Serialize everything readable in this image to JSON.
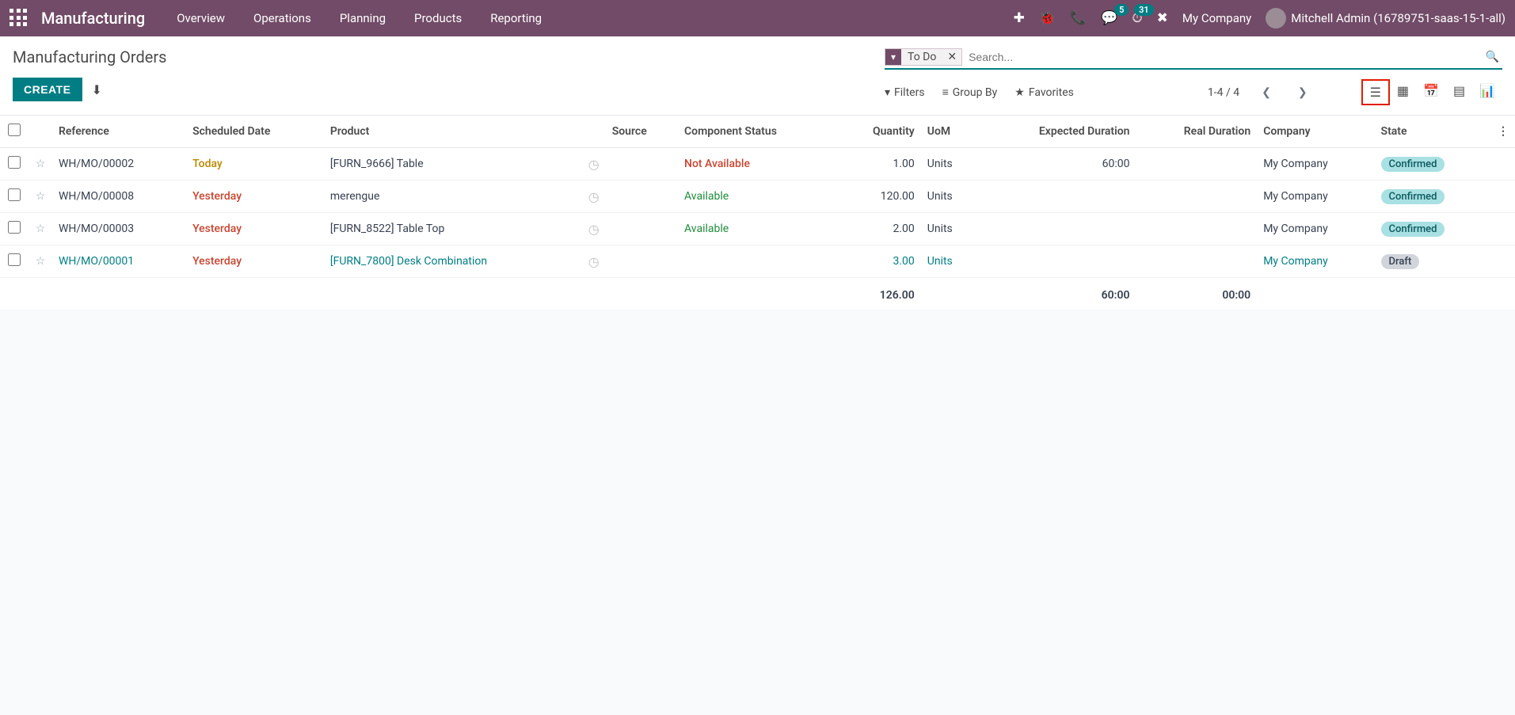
{
  "nav": {
    "brand": "Manufacturing",
    "menu": [
      "Overview",
      "Operations",
      "Planning",
      "Products",
      "Reporting"
    ],
    "badges": {
      "chat": "5",
      "activity": "31"
    },
    "company": "My Company",
    "user": "Mitchell Admin (16789751-saas-15-1-all)"
  },
  "page": {
    "title": "Manufacturing Orders",
    "create": "CREATE"
  },
  "search": {
    "facet_label": "To Do",
    "placeholder": "Search..."
  },
  "toolbar": {
    "filters": "Filters",
    "group_by": "Group By",
    "favorites": "Favorites",
    "pager": "1-4 / 4"
  },
  "columns": {
    "reference": "Reference",
    "scheduled": "Scheduled Date",
    "product": "Product",
    "source": "Source",
    "component_status": "Component Status",
    "quantity": "Quantity",
    "uom": "UoM",
    "expected": "Expected Duration",
    "real": "Real Duration",
    "company": "Company",
    "state": "State"
  },
  "rows": [
    {
      "ref": "WH/MO/00002",
      "sched": "Today",
      "sched_cls": "txt-warn",
      "product": "[FURN_9666] Table",
      "comp": "Not Available",
      "comp_cls": "txt-danger",
      "qty": "1.00",
      "uom": "Units",
      "exp": "60:00",
      "real": "",
      "company": "My Company",
      "state": "Confirmed",
      "state_cls": "state-confirmed",
      "link": false
    },
    {
      "ref": "WH/MO/00008",
      "sched": "Yesterday",
      "sched_cls": "txt-danger",
      "product": "merengue",
      "comp": "Available",
      "comp_cls": "txt-success",
      "qty": "120.00",
      "uom": "Units",
      "exp": "",
      "real": "",
      "company": "My Company",
      "state": "Confirmed",
      "state_cls": "state-confirmed",
      "link": false
    },
    {
      "ref": "WH/MO/00003",
      "sched": "Yesterday",
      "sched_cls": "txt-danger",
      "product": "[FURN_8522] Table Top",
      "comp": "Available",
      "comp_cls": "txt-success",
      "qty": "2.00",
      "uom": "Units",
      "exp": "",
      "real": "",
      "company": "My Company",
      "state": "Confirmed",
      "state_cls": "state-confirmed",
      "link": false
    },
    {
      "ref": "WH/MO/00001",
      "sched": "Yesterday",
      "sched_cls": "txt-danger",
      "product": "[FURN_7800] Desk Combination",
      "comp": "",
      "comp_cls": "",
      "qty": "3.00",
      "uom": "Units",
      "exp": "",
      "real": "",
      "company": "My Company",
      "state": "Draft",
      "state_cls": "state-draft",
      "link": true
    }
  ],
  "sums": {
    "qty": "126.00",
    "exp": "60:00",
    "real": "00:00"
  }
}
